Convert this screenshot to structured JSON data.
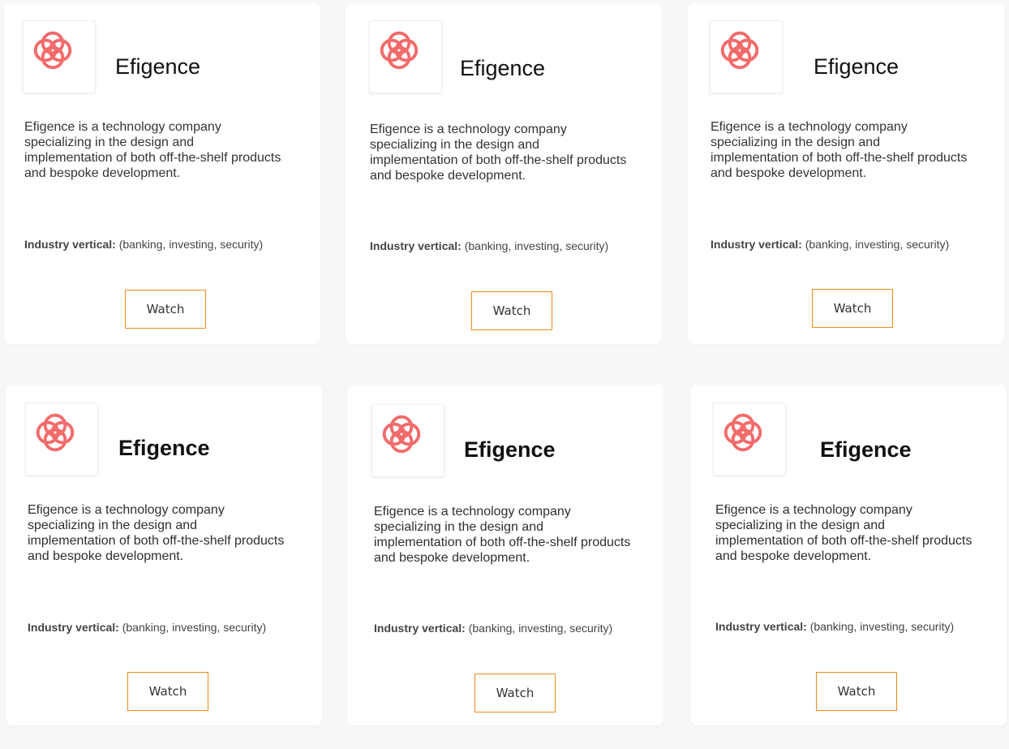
{
  "brand": {
    "accent": "#f08a1c",
    "logo_color": "#f26b6b"
  },
  "cards": [
    {
      "name": "Efigence",
      "description": "Efigence is a technology company specializing in the design and implementation of both off-the-shelf products and bespoke development.",
      "industry_label": "Industry vertical:",
      "industry_value": " (banking, investing, security)",
      "button_label": "Watch",
      "logo_icon": "efigence-logo-icon"
    },
    {
      "name": "Efigence",
      "description": "Efigence is a technology company specializing in the design and implementation of both off-the-shelf products and bespoke development.",
      "industry_label": "Industry vertical:",
      "industry_value": " (banking, investing, security)",
      "button_label": "Watch",
      "logo_icon": "efigence-logo-icon"
    },
    {
      "name": "Efigence",
      "description": "Efigence is a technology company specializing in the design and implementation of both off-the-shelf products and bespoke development.",
      "industry_label": "Industry vertical:",
      "industry_value": " (banking, investing, security)",
      "button_label": "Watch",
      "logo_icon": "efigence-logo-icon"
    },
    {
      "name": "Efigence",
      "description": "Efigence is a technology company specializing in the design and implementation of both off-the-shelf products and bespoke development.",
      "industry_label": "Industry vertical:",
      "industry_value": " (banking, investing, security)",
      "button_label": "Watch",
      "logo_icon": "efigence-logo-icon"
    },
    {
      "name": "Efigence",
      "description": "Efigence is a technology company specializing in the design and implementation of both off-the-shelf products and bespoke development.",
      "industry_label": "Industry vertical:",
      "industry_value": " (banking, investing, security)",
      "button_label": "Watch",
      "logo_icon": "efigence-logo-icon"
    },
    {
      "name": "Efigence",
      "description": "Efigence is a technology company specializing in the design and implementation of both off-the-shelf products and bespoke development.",
      "industry_label": "Industry vertical:",
      "industry_value": " (banking, investing, security)",
      "button_label": "Watch",
      "logo_icon": "efigence-logo-icon"
    }
  ]
}
